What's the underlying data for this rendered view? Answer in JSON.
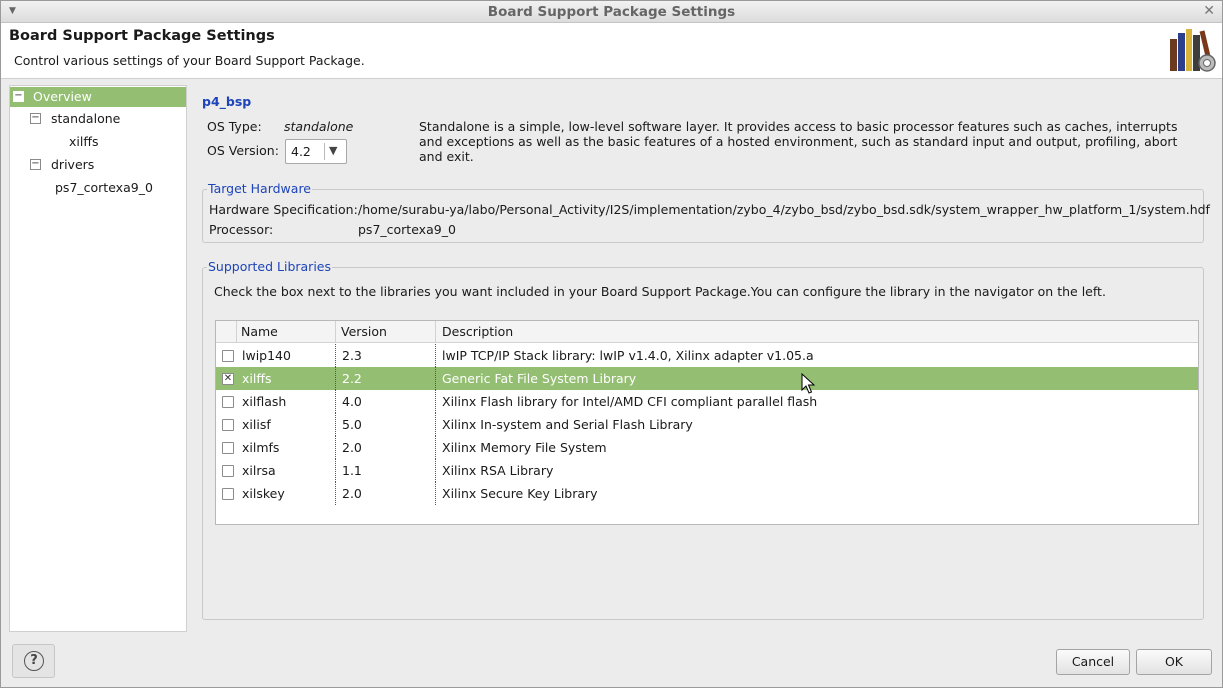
{
  "window": {
    "title": "Board Support Package Settings"
  },
  "header": {
    "title": "Board Support Package Settings",
    "description": "Control various settings of your Board Support Package."
  },
  "nav": {
    "items": [
      {
        "label": "Overview",
        "toggle": "−",
        "selected": true
      },
      {
        "label": "standalone",
        "toggle": "−"
      },
      {
        "label": "xilffs"
      },
      {
        "label": "drivers",
        "toggle": "−"
      },
      {
        "label": "ps7_cortexa9_0"
      }
    ]
  },
  "overview": {
    "bsp_name": "p4_bsp",
    "os_type_label": "OS Type:",
    "os_type_value": "standalone",
    "os_version_label": "OS Version:",
    "os_version_value": "4.2",
    "os_description": "Standalone is a simple, low-level software layer. It provides access to basic processor features such as caches, interrupts and exceptions as well as the basic features of a hosted environment, such as standard input and output, profiling, abort and exit."
  },
  "target_hardware": {
    "title": "Target Hardware",
    "hw_spec_label": "Hardware Specification:",
    "hw_spec_value": "/home/surabu-ya/labo/Personal_Activity/I2S/implementation/zybo_4/zybo_bsd/zybo_bsd.sdk/system_wrapper_hw_platform_1/system.hdf",
    "processor_label": "Processor:",
    "processor_value": "ps7_cortexa9_0"
  },
  "libraries": {
    "title": "Supported Libraries",
    "instructions": "Check the box next to the libraries you want included in your Board Support Package.You can configure the library in the navigator on the left.",
    "columns": {
      "name": "Name",
      "version": "Version",
      "description": "Description"
    },
    "rows": [
      {
        "name": "lwip140",
        "version": "2.3",
        "description": "lwIP TCP/IP Stack library: lwIP v1.4.0, Xilinx adapter v1.05.a",
        "checked": false
      },
      {
        "name": "xilffs",
        "version": "2.2",
        "description": "Generic Fat File System Library",
        "checked": true
      },
      {
        "name": "xilflash",
        "version": "4.0",
        "description": "Xilinx Flash library for Intel/AMD CFI compliant parallel flash",
        "checked": false
      },
      {
        "name": "xilisf",
        "version": "5.0",
        "description": "Xilinx In-system and Serial Flash Library",
        "checked": false
      },
      {
        "name": "xilmfs",
        "version": "2.0",
        "description": "Xilinx Memory File System",
        "checked": false
      },
      {
        "name": "xilrsa",
        "version": "1.1",
        "description": "Xilinx RSA Library",
        "checked": false
      },
      {
        "name": "xilskey",
        "version": "2.0",
        "description": "Xilinx Secure Key Library",
        "checked": false
      }
    ]
  },
  "footer": {
    "help_glyph": "?",
    "cancel_label": "Cancel",
    "ok_label": "OK"
  },
  "colors": {
    "selection": "#94bf73",
    "link_blue": "#1d44b8"
  }
}
